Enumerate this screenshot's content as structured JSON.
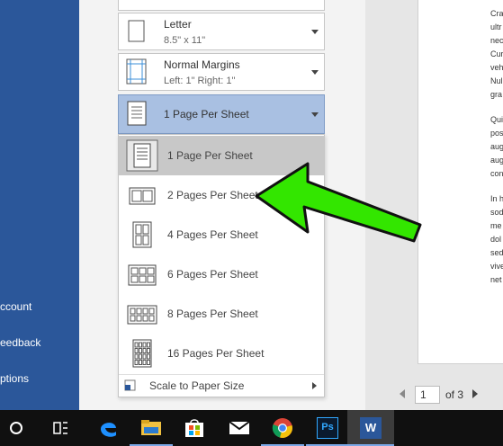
{
  "backstage": {
    "items": [
      {
        "label": "ccount"
      },
      {
        "label": "eedback"
      },
      {
        "label": "ptions"
      }
    ]
  },
  "paper": {
    "title": "Letter",
    "sub": "8.5\" x 11\""
  },
  "margins": {
    "title": "Normal Margins",
    "sub": "Left:  1\"    Right:  1\""
  },
  "pages_per_sheet": {
    "selected": "1 Page Per Sheet"
  },
  "menu": {
    "items": [
      {
        "label": "1 Page Per Sheet",
        "cols": 1,
        "rows": 1
      },
      {
        "label": "2 Pages Per Sheet",
        "cols": 2,
        "rows": 1
      },
      {
        "label": "4 Pages Per Sheet",
        "cols": 2,
        "rows": 2
      },
      {
        "label": "6 Pages Per Sheet",
        "cols": 3,
        "rows": 2
      },
      {
        "label": "8 Pages Per Sheet",
        "cols": 4,
        "rows": 2
      },
      {
        "label": "16 Pages Per Sheet",
        "cols": 4,
        "rows": 4
      }
    ],
    "scale_label": "Scale to Paper Size"
  },
  "document_lines": [
    "Cra",
    "ultr",
    "nec",
    "Cur",
    "veh",
    "Nul",
    "gra",
    "",
    "Qui",
    "pos",
    "aug",
    "aug",
    "con",
    "",
    "In h",
    "sod",
    "me",
    "dol",
    "sed",
    "vive",
    "net"
  ],
  "pager": {
    "current": "1",
    "of": "of 3"
  },
  "colors": {
    "accent": "#2b579a",
    "selected": "#a9c0e2",
    "arrow": "#33e600"
  },
  "taskbar": {
    "icons": [
      "cortana-icon",
      "task-view-icon",
      "edge-icon",
      "file-explorer-icon",
      "store-icon",
      "mail-icon",
      "chrome-icon",
      "photoshop-icon",
      "word-icon"
    ],
    "ps": "Ps",
    "word": "W"
  }
}
